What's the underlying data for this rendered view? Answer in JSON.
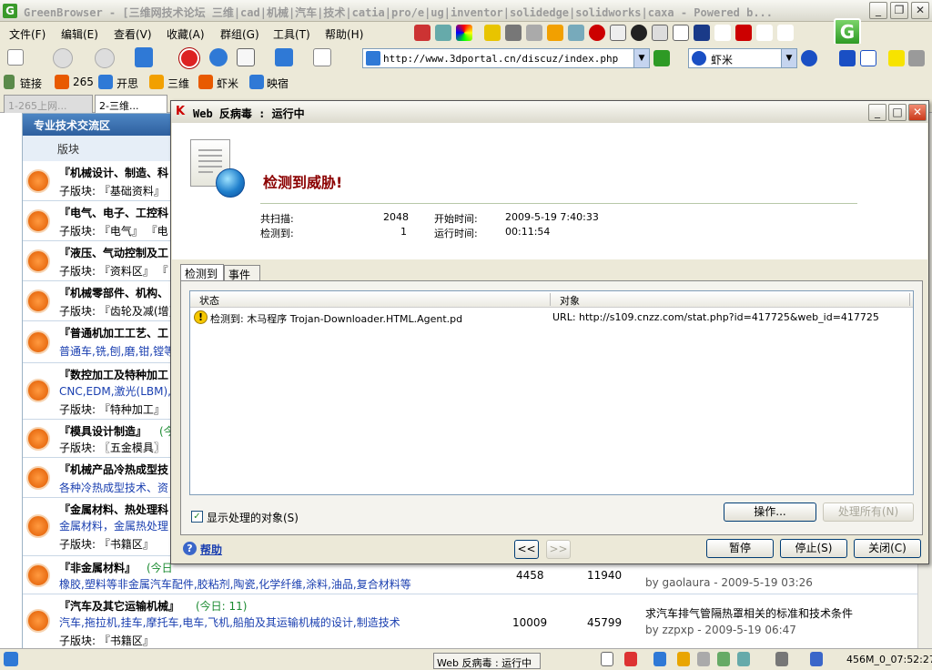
{
  "window": {
    "title": "GreenBrowser - [三维网技术论坛 三维|cad|机械|汽车|技术|catia|pro/e|ug|inventor|solidedge|solidworks|caxa - Powered b..."
  },
  "menu": [
    "文件(F)",
    "编辑(E)",
    "查看(V)",
    "收藏(A)",
    "群组(G)",
    "工具(T)",
    "帮助(H)"
  ],
  "address": {
    "url": "http://www.3dportal.cn/discuz/index.php"
  },
  "search": {
    "engine": "虾米"
  },
  "favorites": [
    "链接",
    "265",
    "开思",
    "三维",
    "虾米",
    "映宿"
  ],
  "tabs": [
    "1-265上网...",
    "2-三维..."
  ],
  "forum": {
    "section": "专业技术交流区",
    "column": "版块",
    "rows": [
      {
        "title": "『机械设计、制造、科",
        "sub": "子版块: 『基础资料』"
      },
      {
        "title": "『电气、电子、工控科",
        "sub": "子版块: 『电气』 『电"
      },
      {
        "title": "『液压、气动控制及工",
        "sub": "子版块: 『资料区』 『"
      },
      {
        "title": "『机械零部件、机构、",
        "sub": "子版块: 『齿轮及减(增)"
      },
      {
        "title": "『普通机加工工艺、工",
        "sub": "普通车,铣,刨,磨,钳,镗等"
      },
      {
        "title": "『数控加工及特种加工",
        "sub": "CNC,EDM,激光(LBM),",
        "sub2": "子版块: 『特种加工』"
      },
      {
        "title": "『模具设计制造』",
        "today": "(今",
        "sub": "子版块: 〖五金模具〗"
      },
      {
        "title": "『机械产品冷热成型技",
        "sub": "各种冷热成型技术、资"
      },
      {
        "title": "『金属材料、热处理科",
        "sub": "金属材料，金属热处理",
        "sub2": "子版块: 『书籍区』"
      },
      {
        "title": "『非金属材料』",
        "today": "(今日",
        "sub": "橡胶,塑料等非金属汽车配件,胶粘剂,陶瓷,化学纤维,涂料,油品,复合材料等",
        "threads": "4458",
        "posts": "11940",
        "last_by": "by gaolaura - 2009-5-19 03:26"
      },
      {
        "title": "『汽车及其它运输机械』",
        "today": "(今日: 11)",
        "sub": "汽车,拖拉机,挂车,摩托车,电车,飞机,船舶及其运输机械的设计,制造技术",
        "sub2": "子版块: 『书籍区』",
        "threads": "10009",
        "posts": "45799",
        "last_topic": "求汽车排气管隔热罩相关的标准和技术条件",
        "last_by": "by zzpxp - 2009-5-19 06:47"
      }
    ]
  },
  "dialog": {
    "title": "Web 反病毒 : 运行中",
    "heading": "检测到威胁!",
    "scanned_label": "共扫描:",
    "scanned_value": "2048",
    "detected_label": "检测到:",
    "detected_value": "1",
    "start_label": "开始时间:",
    "start_value": "2009-5-19 7:40:33",
    "run_label": "运行时间:",
    "run_value": "00:11:54",
    "tabs": [
      "检测到",
      "事件"
    ],
    "col_status": "状态",
    "col_object": "对象",
    "item_status": "检测到: 木马程序 Trojan-Downloader.HTML.Agent.pd",
    "item_object": "URL: http://s109.cnzz.com/stat.php?id=417725&web_id=417725",
    "show_processed": "显示处理的对象(S)",
    "action_btn": "操作...",
    "process_all_btn": "处理所有(N)",
    "help": "帮助",
    "prev": "<<",
    "next": ">>",
    "pause": "暂停",
    "stop": "停止(S)",
    "close": "关闭(C)"
  },
  "status": {
    "task": "Web 反病毒 : 运行中",
    "memory_time": "456M_0_07:52:27"
  }
}
